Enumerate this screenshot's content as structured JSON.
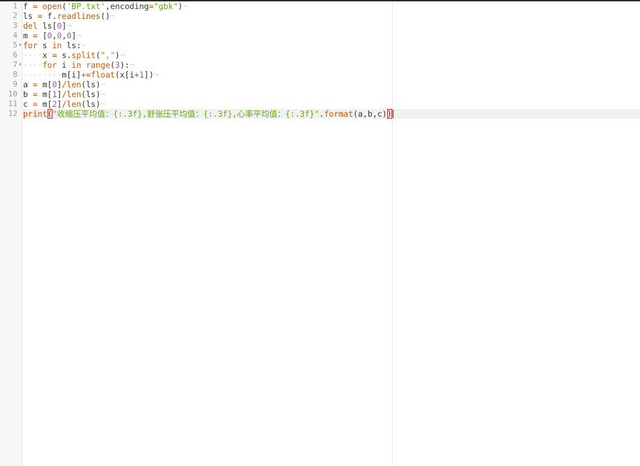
{
  "editor": {
    "colors": {
      "keyword": "#d35400",
      "builtin": "#d35400",
      "string": "#66aa11",
      "number": "#9b59b6",
      "operator": "#d35400",
      "default": "#333333",
      "whitespace_marker": "#d2d2d2",
      "bracket_match": "#e03030"
    },
    "active_line": 12,
    "lines": [
      {
        "num": "1",
        "fold": "",
        "indent": "",
        "eol": "¬",
        "tokens": [
          [
            "f ",
            "d"
          ],
          [
            "=",
            "o"
          ],
          [
            " ",
            "d"
          ],
          [
            "open",
            "b"
          ],
          [
            "(",
            "d"
          ],
          [
            "'BP.txt'",
            "s"
          ],
          [
            ",encoding",
            "d"
          ],
          [
            "=",
            "o"
          ],
          [
            "\"gbk\"",
            "s"
          ],
          [
            ")",
            "d"
          ]
        ]
      },
      {
        "num": "2",
        "fold": "",
        "indent": "",
        "eol": "¬",
        "tokens": [
          [
            "ls ",
            "d"
          ],
          [
            "=",
            "o"
          ],
          [
            " f.",
            "d"
          ],
          [
            "readlines",
            "b"
          ],
          [
            "()",
            "d"
          ]
        ]
      },
      {
        "num": "3",
        "fold": "",
        "indent": "",
        "eol": "¬",
        "tokens": [
          [
            "del",
            "k"
          ],
          [
            " ls[",
            "d"
          ],
          [
            "0",
            "n"
          ],
          [
            "]",
            "d"
          ]
        ]
      },
      {
        "num": "4",
        "fold": "",
        "indent": "",
        "eol": "¬",
        "tokens": [
          [
            "m ",
            "d"
          ],
          [
            "=",
            "o"
          ],
          [
            " [",
            "d"
          ],
          [
            "0",
            "n"
          ],
          [
            ",",
            "d"
          ],
          [
            "0",
            "n"
          ],
          [
            ",",
            "d"
          ],
          [
            "0",
            "n"
          ],
          [
            "]",
            "d"
          ]
        ]
      },
      {
        "num": "5",
        "fold": "▾",
        "indent": "",
        "eol": "¬",
        "tokens": [
          [
            "for",
            "k"
          ],
          [
            " s ",
            "d"
          ],
          [
            "in",
            "k"
          ],
          [
            " ls:",
            "d"
          ]
        ]
      },
      {
        "num": "6",
        "fold": "",
        "indent": "····",
        "eol": "¬",
        "tokens": [
          [
            "x ",
            "d"
          ],
          [
            "=",
            "o"
          ],
          [
            " s.",
            "d"
          ],
          [
            "split",
            "b"
          ],
          [
            "(",
            "d"
          ],
          [
            "\",\"",
            "s"
          ],
          [
            ")",
            "d"
          ]
        ]
      },
      {
        "num": "7",
        "fold": "▾",
        "indent": "····",
        "eol": "¬",
        "tokens": [
          [
            "for",
            "k"
          ],
          [
            " i ",
            "d"
          ],
          [
            "in",
            "k"
          ],
          [
            " ",
            "d"
          ],
          [
            "range",
            "b"
          ],
          [
            "(",
            "d"
          ],
          [
            "3",
            "n"
          ],
          [
            "):",
            "d"
          ]
        ]
      },
      {
        "num": "8",
        "fold": "",
        "indent": "········",
        "eol": "¬",
        "tokens": [
          [
            "m[i]",
            "d"
          ],
          [
            "+=",
            "o"
          ],
          [
            "float",
            "b"
          ],
          [
            "(x[i",
            "d"
          ],
          [
            "+",
            "o"
          ],
          [
            "1",
            "n"
          ],
          [
            "])",
            "d"
          ]
        ]
      },
      {
        "num": "9",
        "fold": "",
        "indent": "",
        "eol": "¬",
        "tokens": [
          [
            "a ",
            "d"
          ],
          [
            "=",
            "o"
          ],
          [
            " m[",
            "d"
          ],
          [
            "0",
            "n"
          ],
          [
            "]",
            "d"
          ],
          [
            "/",
            "o"
          ],
          [
            "len",
            "b"
          ],
          [
            "(ls)",
            "d"
          ]
        ]
      },
      {
        "num": "10",
        "fold": "",
        "indent": "",
        "eol": "¬",
        "tokens": [
          [
            "b ",
            "d"
          ],
          [
            "=",
            "o"
          ],
          [
            " m[",
            "d"
          ],
          [
            "1",
            "n"
          ],
          [
            "]",
            "d"
          ],
          [
            "/",
            "o"
          ],
          [
            "len",
            "b"
          ],
          [
            "(ls)",
            "d"
          ]
        ]
      },
      {
        "num": "11",
        "fold": "",
        "indent": "",
        "eol": "¬",
        "tokens": [
          [
            "c ",
            "d"
          ],
          [
            "=",
            "o"
          ],
          [
            " m[",
            "d"
          ],
          [
            "2",
            "n"
          ],
          [
            "]",
            "d"
          ],
          [
            "/",
            "o"
          ],
          [
            "len",
            "b"
          ],
          [
            "(ls)",
            "d"
          ]
        ]
      },
      {
        "num": "12",
        "fold": "",
        "indent": "",
        "eol": "",
        "tokens": [
          [
            "print",
            "b"
          ],
          [
            "(",
            "bm"
          ],
          [
            "\"收缩压平均值：{:.3f},舒张压平均值：{:.3f},心率平均值：{:.3f}\"",
            "s"
          ],
          [
            ".",
            "d"
          ],
          [
            "format",
            "b"
          ],
          [
            "(a,b,c)",
            "d"
          ],
          [
            ")",
            "bm"
          ],
          [
            "",
            "cursor"
          ]
        ]
      }
    ]
  }
}
